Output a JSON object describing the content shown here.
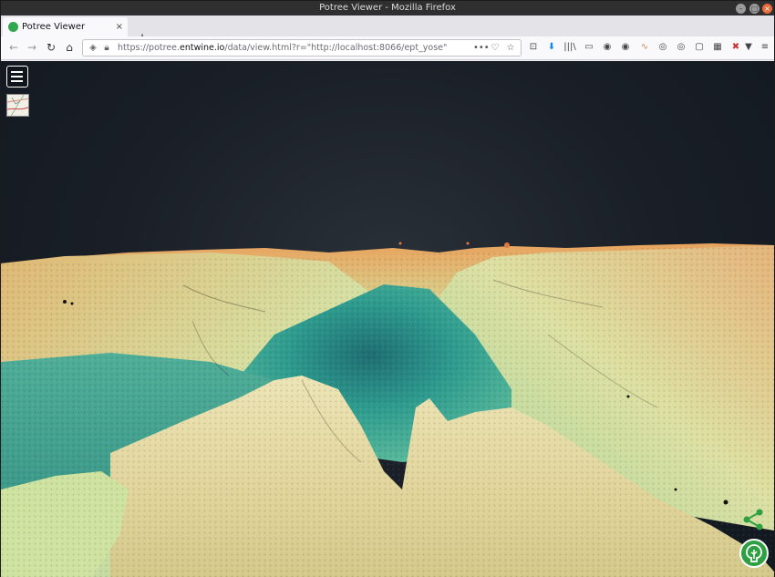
{
  "window": {
    "title": "Potree Viewer - Mozilla Firefox",
    "minimize": "–",
    "maximize": "□",
    "close": "×"
  },
  "tabs": [
    {
      "label": "Potree Viewer",
      "close": "×"
    }
  ],
  "newtab": "+",
  "nav": {
    "back": "←",
    "forward": "→",
    "reload": "↻",
    "home": "⌂"
  },
  "url": {
    "prefix": "https://potree.",
    "domain": "entwine.io",
    "path": "/data/view.html?r=\"http://localhost:8066/ept_yose\"",
    "more": "•••",
    "pocket": "♡",
    "bookmark": "☆"
  },
  "toolbar": {
    "icons": [
      "⊡",
      "⬇",
      "|||\\",
      "▭",
      "◉",
      "◉",
      "∿",
      "◎",
      "◎",
      "▢",
      "▦",
      "✖",
      "▼",
      "≡"
    ]
  },
  "viewer": {
    "menu_icon": "hamburger-menu-icon",
    "map_icon": "map-thumbnail-icon",
    "share_icon": "share-icon",
    "logo": "potree-logo-icon"
  },
  "colors": {
    "sky": "#151b23",
    "terrain_low": "#2e8c84",
    "terrain_mid": "#b8d79a",
    "terrain_high": "#e3b070",
    "accent": "#2ea043"
  }
}
